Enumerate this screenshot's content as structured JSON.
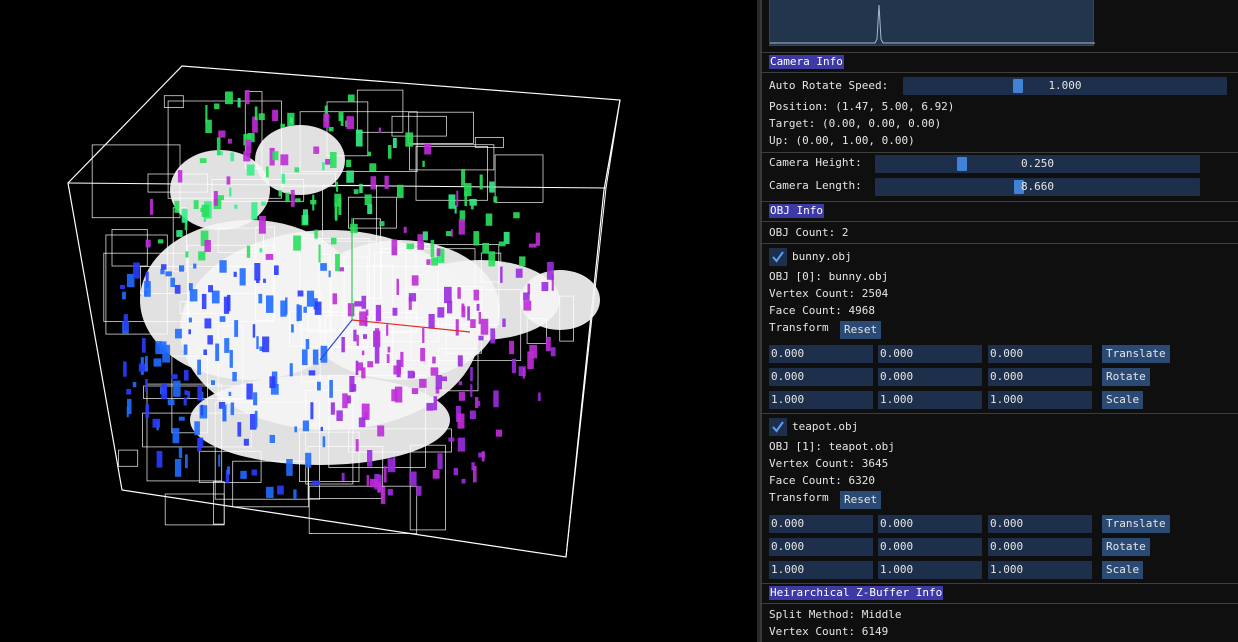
{
  "camera": {
    "header": "Camera Info",
    "auto_rotate_label": "Auto Rotate Speed:",
    "auto_rotate_value": "1.000",
    "auto_rotate_fraction": 0.35,
    "position_text": "Position: (1.47, 5.00, 6.92)",
    "target_text": "Target: (0.00, 0.00, 0.00)",
    "up_text": "Up: (0.00, 1.00, 0.00)",
    "height_label": "Camera Height:",
    "height_value": "0.250",
    "height_fraction": 0.26,
    "length_label": "Camera Length:",
    "length_value": "8.660",
    "length_fraction": 0.44
  },
  "obj": {
    "header": "OBJ Info",
    "count_text": "OBJ Count: 2",
    "objects": [
      {
        "checkbox_label": "bunny.obj",
        "name_text": "OBJ [0]: bunny.obj",
        "vertex_text": "Vertex Count: 2504",
        "face_text": "Face Count: 4968",
        "transform_label": "Transform",
        "reset_label": "Reset",
        "translate": [
          "0.000",
          "0.000",
          "0.000"
        ],
        "rotate": [
          "0.000",
          "0.000",
          "0.000"
        ],
        "scale": [
          "1.000",
          "1.000",
          "1.000"
        ],
        "translate_label": "Translate",
        "rotate_label": "Rotate",
        "scale_label": "Scale"
      },
      {
        "checkbox_label": "teapot.obj",
        "name_text": "OBJ [1]: teapot.obj",
        "vertex_text": "Vertex Count: 3645",
        "face_text": "Face Count: 6320",
        "transform_label": "Transform",
        "reset_label": "Reset",
        "translate": [
          "0.000",
          "0.000",
          "0.000"
        ],
        "rotate": [
          "0.000",
          "0.000",
          "0.000"
        ],
        "scale": [
          "1.000",
          "1.000",
          "1.000"
        ],
        "translate_label": "Translate",
        "rotate_label": "Rotate",
        "scale_label": "Scale"
      }
    ]
  },
  "hzb": {
    "header": "Heirarchical Z-Buffer Info",
    "split_text": "Split Method: Middle",
    "vertex_text": "Vertex Count: 6149"
  },
  "colors": {
    "header_bg": "#3d3aa6",
    "frame_bg": "#1d2f4a",
    "button_bg": "#2a4a74",
    "slider_grab": "#3f82d6"
  }
}
